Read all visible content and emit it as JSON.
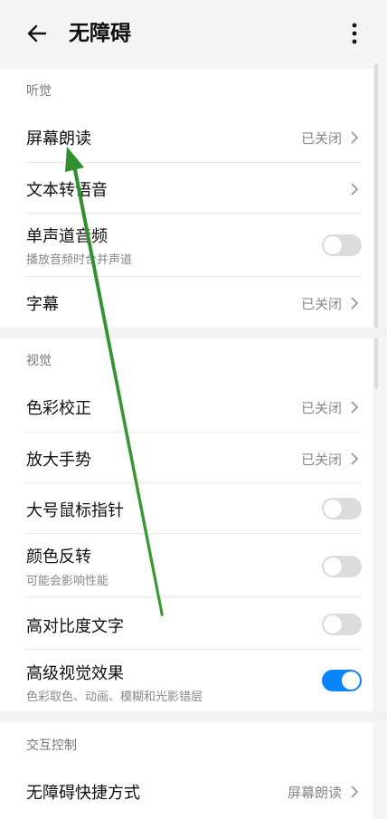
{
  "header": {
    "title": "无障碍",
    "back_icon": "back-arrow-icon",
    "more_icon": "more-vertical-icon"
  },
  "sections": {
    "hearing": {
      "title": "听觉",
      "items": [
        {
          "label": "屏幕朗读",
          "value": "已关闭"
        },
        {
          "label": "文本转语音",
          "value": ""
        },
        {
          "label": "单声道音频",
          "subtitle": "播放音频时合并声道",
          "toggle_on": false
        },
        {
          "label": "字幕",
          "value": "已关闭"
        }
      ]
    },
    "vision": {
      "title": "视觉",
      "items": [
        {
          "label": "色彩校正",
          "value": "已关闭"
        },
        {
          "label": "放大手势",
          "value": "已关闭"
        },
        {
          "label": "大号鼠标指针",
          "toggle_on": false
        },
        {
          "label": "颜色反转",
          "subtitle": "可能会影响性能",
          "toggle_on": false
        },
        {
          "label": "高对比度文字",
          "toggle_on": false
        },
        {
          "label": "高级视觉效果",
          "subtitle": "色彩取色、动画、模糊和光影错层",
          "toggle_on": true
        }
      ]
    },
    "interaction": {
      "title": "交互控制",
      "items": [
        {
          "label": "无障碍快捷方式",
          "value": "屏幕朗读"
        }
      ]
    }
  },
  "colors": {
    "accent": "#0a84ff",
    "annotation_arrow": "#2e8b2e"
  }
}
